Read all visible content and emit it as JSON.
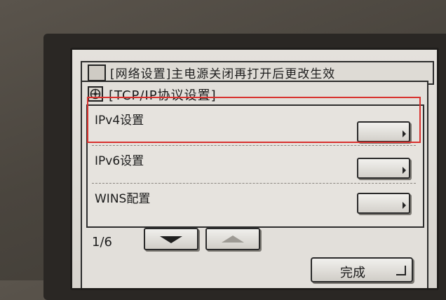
{
  "back_window": {
    "title": "[网络设置]主电源关闭再打开后更改生效"
  },
  "window": {
    "title": "[TCP/IP协议设置]",
    "icon": "network-settings-icon"
  },
  "list": {
    "items": [
      {
        "label": "IPv4设置",
        "button_icon": "right-arrow-icon"
      },
      {
        "label": "IPv6设置",
        "button_icon": "right-arrow-icon"
      },
      {
        "label": "WINS配置",
        "button_icon": "right-arrow-icon"
      }
    ]
  },
  "pager": {
    "indicator": "1/6",
    "down_icon": "arrow-down-icon",
    "up_icon": "arrow-up-icon"
  },
  "done_button": {
    "label": "完成",
    "icon": "return-icon"
  },
  "highlight": {
    "color": "#d8312e",
    "target": "IPv4设置"
  }
}
